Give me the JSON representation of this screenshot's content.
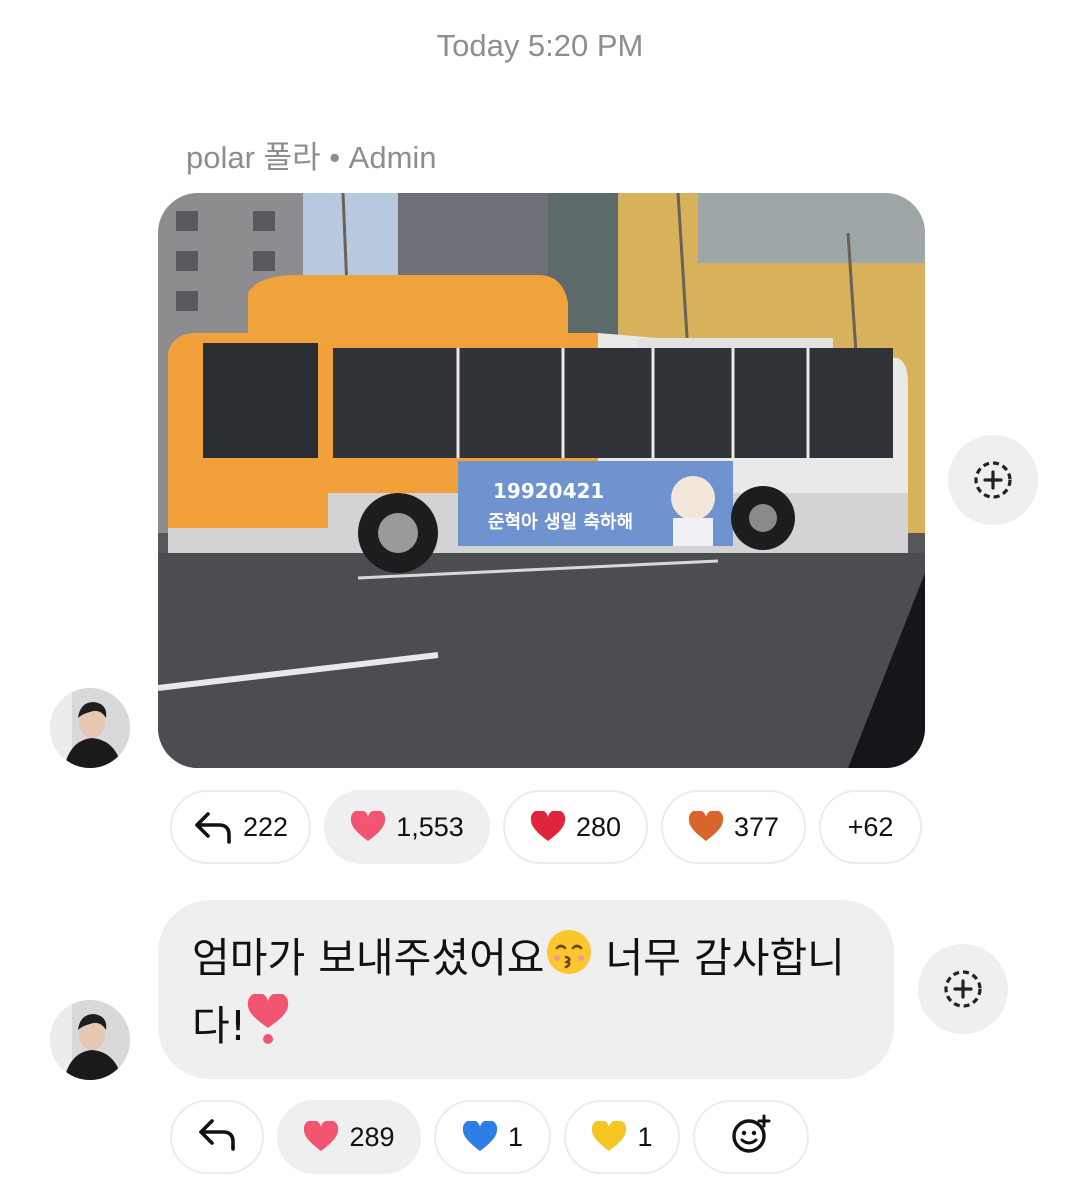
{
  "timestamp": "Today 5:20 PM",
  "message1": {
    "sender": "polar 폴라 • Admin",
    "photo": {
      "ad_date": "19920421",
      "ad_text": "준혁아 생일 축하해"
    },
    "reactions": [
      {
        "icon": "reply-icon",
        "count": "222"
      },
      {
        "icon": "pink-heart-icon",
        "count": "1,553",
        "active": true
      },
      {
        "icon": "red-heart-icon",
        "count": "280"
      },
      {
        "icon": "orange-heart-icon",
        "count": "377"
      },
      {
        "icon": "",
        "count": "+62"
      }
    ]
  },
  "message2": {
    "text_line1": "엄마가 보내주셨어요",
    "text_line1b": " 너무 감사합니",
    "text_line2": "다!",
    "emoji_1": "kissing-face-icon",
    "emoji_2": "heart-exclamation-icon",
    "reactions": [
      {
        "icon": "reply-icon",
        "count": ""
      },
      {
        "icon": "pink-heart-icon",
        "count": "289",
        "active": true
      },
      {
        "icon": "blue-heart-icon",
        "count": "1"
      },
      {
        "icon": "yellow-heart-icon",
        "count": "1"
      },
      {
        "icon": "add-reaction-icon",
        "count": ""
      }
    ]
  },
  "colors": {
    "bubble": "#efefef",
    "muted_text": "#8e8e8e",
    "pink_heart": "#f2556f",
    "red_heart": "#e0243c",
    "orange_heart": "#d9652e",
    "blue_heart": "#2f7ee8",
    "yellow_heart": "#f5c524"
  }
}
